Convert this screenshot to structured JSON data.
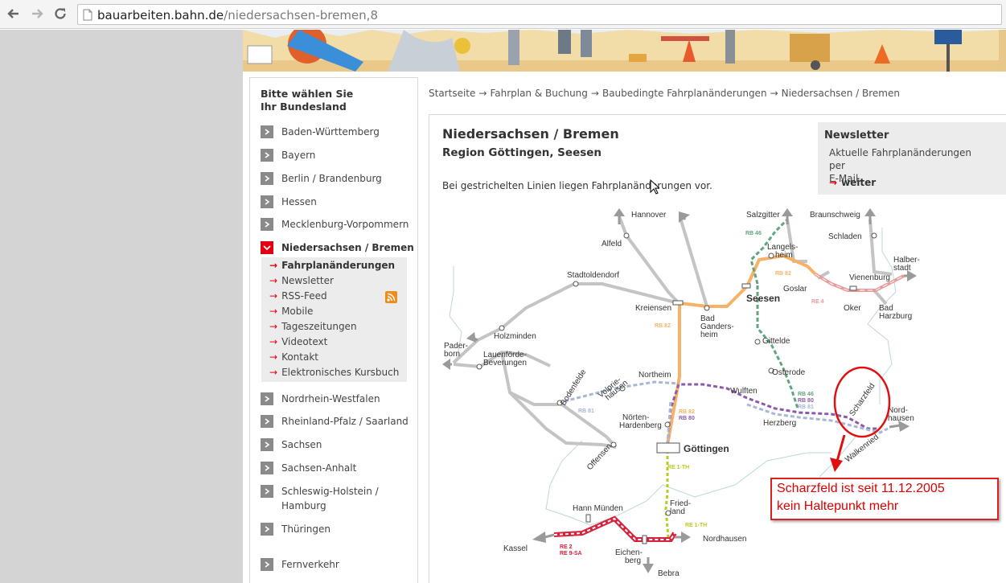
{
  "browser": {
    "url_host": "bauarbeiten.bahn.de",
    "url_path": "/niedersachsen-bremen,8"
  },
  "sidebar": {
    "title_line1": "Bitte wählen Sie",
    "title_line2": "Ihr Bundesland",
    "items": [
      {
        "label": "Baden-Württemberg"
      },
      {
        "label": "Bayern"
      },
      {
        "label": "Berlin / Brandenburg"
      },
      {
        "label": "Hessen"
      },
      {
        "label": "Mecklenburg-Vorpommern"
      },
      {
        "label": "Niedersachsen / Bremen"
      },
      {
        "label": "Nordrhein-Westfalen"
      },
      {
        "label": "Rheinland-Pfalz / Saarland"
      },
      {
        "label": "Sachsen"
      },
      {
        "label": "Sachsen-Anhalt"
      },
      {
        "label_line1": "Schleswig-Holstein /",
        "label_line2": "Hamburg"
      },
      {
        "label": "Thüringen"
      },
      {
        "label": "Fernverkehr"
      }
    ],
    "submenu": [
      {
        "label": "Fahrplanänderungen"
      },
      {
        "label": "Newsletter"
      },
      {
        "label": "RSS-Feed"
      },
      {
        "label": "Mobile"
      },
      {
        "label": "Tageszeitungen"
      },
      {
        "label": "Videotext"
      },
      {
        "label": "Kontakt"
      },
      {
        "label": "Elektronisches Kursbuch"
      }
    ]
  },
  "breadcrumb": [
    "Startseite",
    "Fahrplan & Buchung",
    "Baubedingte Fahrplanänderungen",
    "Niedersachsen / Bremen"
  ],
  "content": {
    "title": "Niedersachsen / Bremen",
    "subtitle": "Region Göttingen, Seesen",
    "note": "Bei gestrichelten Linien liegen Fahrplanänderungen vor."
  },
  "newsletter": {
    "title": "Newsletter",
    "text_line1": "Aktuelle Fahrplanänderungen per",
    "text_line2": "E-Mail.",
    "link": "weiter"
  },
  "map": {
    "stations": {
      "hannover": "Hannover",
      "alfeld": "Alfeld",
      "stadtoldendorf": "Stadtoldendorf",
      "kreiensen": "Kreiensen",
      "holzminden": "Holzminden",
      "paderborn_1": "Pader-",
      "paderborn_2": "born",
      "lauenfoerde_1": "Lauenförde-",
      "lauenfoerde_2": "Beverungen",
      "bad_gandersheim_1": "Bad",
      "bad_gandersheim_2": "Ganders-",
      "bad_gandersheim_3": "heim",
      "seesen": "Seesen",
      "salzgitter": "Salzgitter",
      "braunschweig": "Braunschweig",
      "schladen": "Schladen",
      "langelsheim_1": "Langels-",
      "langelsheim_2": "heim",
      "goslar": "Goslar",
      "vienenburg": "Vienenburg",
      "halberstadt_1": "Halber-",
      "halberstadt_2": "stadt",
      "oker": "Oker",
      "bad_harzburg_1": "Bad",
      "bad_harzburg_2": "Harzburg",
      "gittelde": "Gittelde",
      "osterode": "Osterode",
      "northeim": "Northeim",
      "bodenfelde": "Bodenfelde",
      "volpriehausen_1": "Volprie-",
      "volpriehausen_2": "hausen",
      "wulften": "Wulften",
      "herzberg": "Herzberg",
      "noerten_1": "Nörten-",
      "noerten_2": "Hardenberg",
      "goettingen": "Göttingen",
      "offensen": "Offensen",
      "scharzfeld": "Scharzfeld",
      "nordhausen_1": "Nord-",
      "nordhausen_2": "hausen",
      "walkenried": "Walkenried",
      "friedland_1": "Fried-",
      "friedland_2": "land",
      "hann_muenden": "Hann Münden",
      "nordhausen_s": "Nordhausen",
      "kassel": "Kassel",
      "eichenberg_1": "Eichen-",
      "eichenberg_2": "berg",
      "bebra": "Bebra"
    },
    "lines": {
      "rb46_a": "RB 46",
      "rb82_a": "RB 82",
      "re4": "RE 4",
      "rb82_b": "RB 82",
      "rb46_b": "RB 46",
      "rb80_a": "RB 80",
      "rb81_a": "RB 81",
      "rb81_b": "RB 81",
      "rb82_c": "RB 82",
      "rb80_b": "RB 80",
      "re1th_a": "RE 1-TH",
      "re1th_b": "RE 1-TH",
      "re2": "RE 2",
      "re9sa": "RE 9-SA"
    }
  },
  "callout": {
    "line1": "Scharzfeld ist seit 11.12.2005",
    "line2": "kein Haltepunkt mehr"
  },
  "colors": {
    "db_red": "#e3000f",
    "rb82": "#f7b267",
    "rb46": "#5fa57e",
    "rb80": "#8b5aa8",
    "rb81": "#a9b6d8",
    "re4": "#e89a9a",
    "re1th": "#b8cc1e",
    "re2": "#d8213a"
  }
}
